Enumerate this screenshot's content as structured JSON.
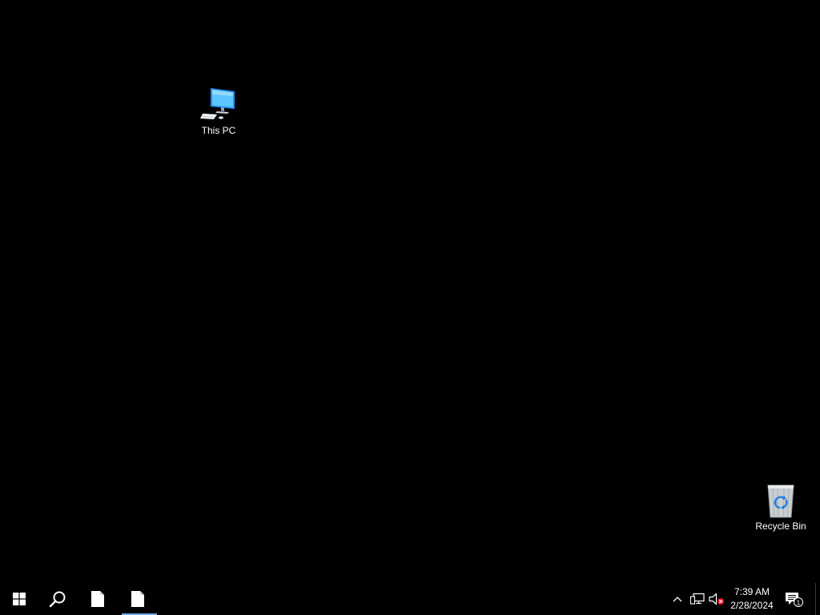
{
  "desktop": {
    "icons": [
      {
        "label": "This PC",
        "icon": "this-pc-icon"
      },
      {
        "label": "Recycle Bin",
        "icon": "recycle-bin-icon"
      }
    ]
  },
  "taskbar": {
    "start": {
      "icon": "windows-logo-icon"
    },
    "search": {
      "icon": "search-icon"
    },
    "apps": [
      {
        "icon": "blank-document-icon",
        "active": false
      },
      {
        "icon": "blank-document-icon",
        "active": true
      }
    ],
    "tray": {
      "chevron_icon": "chevron-up-icon",
      "network_icon": "network-icon",
      "volume_icon": "volume-muted-icon",
      "time": "7:39 AM",
      "date": "2/28/2024",
      "notification_icon": "action-center-icon",
      "notification_count": "1"
    }
  },
  "colors": {
    "desktop_bg": "#000000",
    "taskbar_bg": "#000000",
    "accent": "#6ea8e6",
    "text": "#ffffff"
  }
}
